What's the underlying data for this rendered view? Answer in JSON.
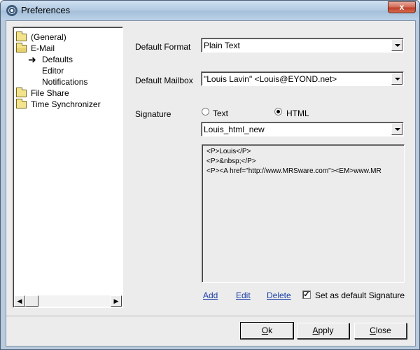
{
  "window": {
    "title": "Preferences",
    "close_glyph": "x"
  },
  "tree": {
    "items": [
      {
        "label": "(General)",
        "icon": "folder-icon"
      },
      {
        "label": "E-Mail",
        "icon": "folder-open-icon"
      },
      {
        "label": "Defaults",
        "icon": "arrow-right-icon"
      },
      {
        "label": "Editor",
        "icon": ""
      },
      {
        "label": "Notifications",
        "icon": ""
      },
      {
        "label": "File Share",
        "icon": "folder-icon"
      },
      {
        "label": "Time Synchronizer",
        "icon": "folder-icon"
      }
    ],
    "scroll_left_glyph": "◀",
    "scroll_right_glyph": "▶"
  },
  "form": {
    "default_format_label": "Default Format",
    "default_format_value": "Plain Text",
    "default_mailbox_label": "Default Mailbox",
    "default_mailbox_value": "\"Louis Lavin\" <Louis@EYOND.net>",
    "signature_label": "Signature",
    "radio_text_label": "Text",
    "radio_html_label": "HTML",
    "signature_selected": "HTML",
    "signature_name": "Louis_html_new",
    "signature_lines": [
      "<P>Louis</P>",
      "<P>&nbsp;</P>",
      "<P><A href=\"http://www.MRSware.com\"><EM>www.MR"
    ],
    "add_label": "Add",
    "edit_label": "Edit",
    "delete_label": "Delete",
    "set_default_label": "Set as default Signature",
    "set_default_checked": true,
    "check_glyph": "✓"
  },
  "buttons": {
    "ok_mnemonic": "O",
    "ok_rest": "k",
    "apply_mnemonic": "A",
    "apply_rest": "pply",
    "close_mnemonic": "C",
    "close_rest": "lose"
  }
}
